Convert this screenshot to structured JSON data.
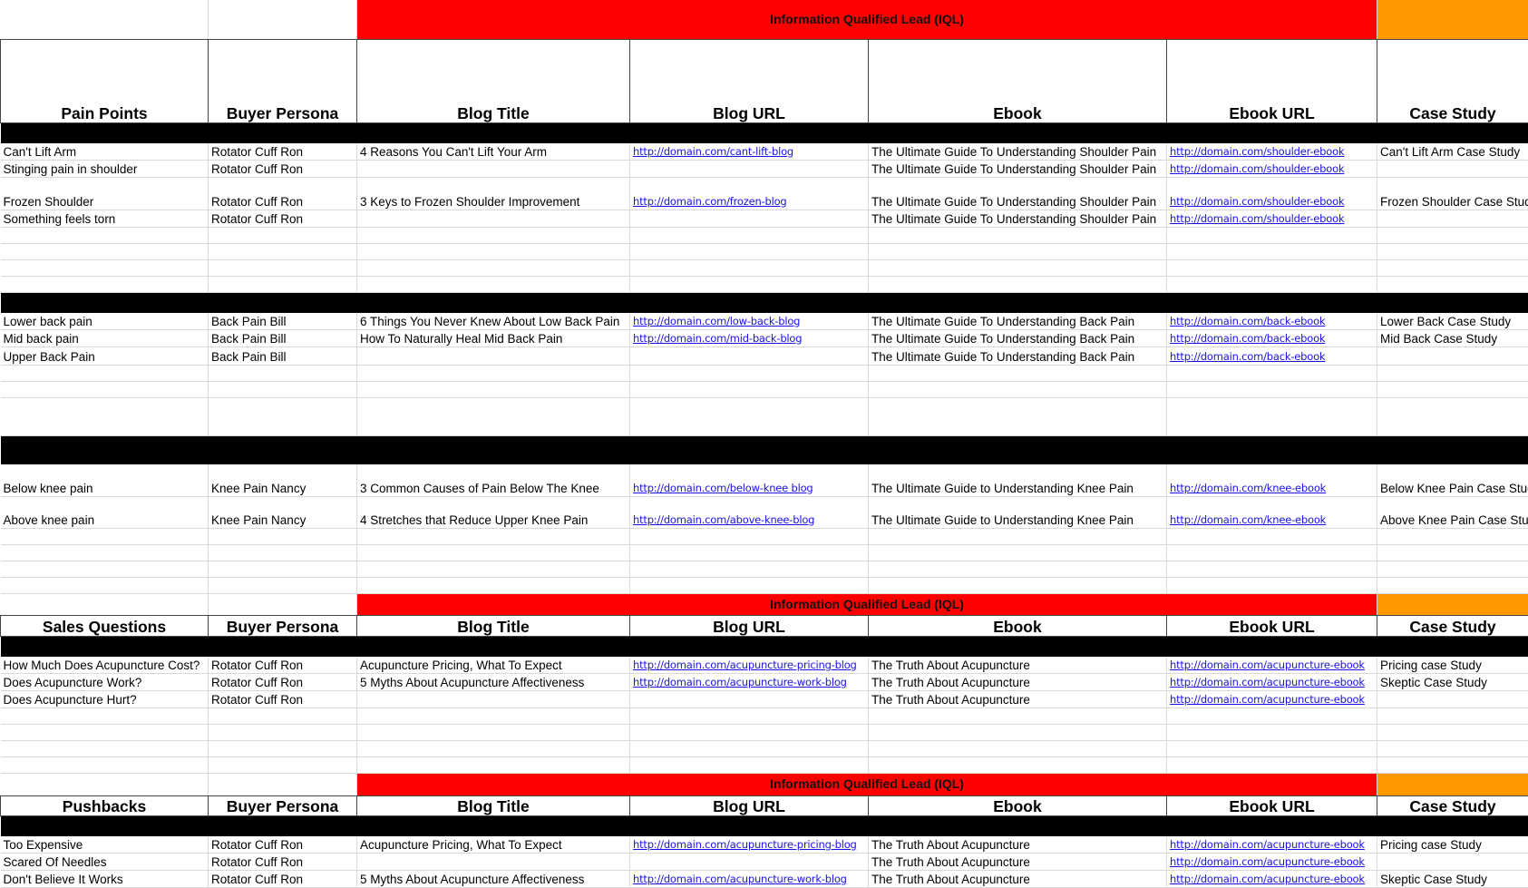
{
  "iql_label": "Information Qualified Lead (IQL)",
  "colors": {
    "iql_red": "#ff0000",
    "case_study_orange": "#ff9900",
    "section_divider": "#000000",
    "link": "#1a12e6"
  },
  "columns": [
    "Buyer Persona",
    "Blog Title",
    "Blog URL",
    "Ebook",
    "Ebook URL",
    "Case Study"
  ],
  "sections": [
    {
      "first_column": "Pain Points",
      "groups": [
        [
          [
            "Can't Lift Arm",
            "Rotator Cuff Ron",
            "4 Reasons You Can't Lift Your Arm",
            "http://domain.com/cant-lift-blog",
            "The Ultimate Guide To Understanding Shoulder Pain",
            "http://domain.com/shoulder-ebook",
            "Can't Lift Arm Case Study"
          ],
          [
            "Stinging pain in shoulder",
            "Rotator Cuff Ron",
            "",
            "",
            "The Ultimate Guide To Understanding Shoulder Pain",
            "http://domain.com/shoulder-ebook",
            ""
          ],
          [
            "Frozen Shoulder",
            "Rotator Cuff Ron",
            "3 Keys to Frozen Shoulder Improvement",
            "http://domain.com/frozen-blog",
            "The Ultimate Guide To Understanding Shoulder Pain",
            "http://domain.com/shoulder-ebook",
            "Frozen Shoulder Case Study"
          ],
          [
            "Something feels torn",
            "Rotator Cuff Ron",
            "",
            "",
            "The Ultimate Guide To Understanding Shoulder Pain",
            "http://domain.com/shoulder-ebook",
            ""
          ]
        ],
        [
          [
            "Lower back pain",
            "Back Pain Bill",
            "6 Things You Never Knew About Low Back Pain",
            "http://domain.com/low-back-blog",
            "The Ultimate Guide To Understanding Back Pain",
            "http://domain.com/back-ebook",
            "Lower Back Case Study"
          ],
          [
            "Mid back pain",
            "Back Pain Bill",
            "How To Naturally Heal Mid Back Pain",
            "http://domain.com/mid-back-blog",
            "The Ultimate Guide To Understanding Back Pain",
            "http://domain.com/back-ebook",
            "Mid Back Case Study"
          ],
          [
            "Upper Back Pain",
            "Back Pain Bill",
            "",
            "",
            "The Ultimate Guide To Understanding Back Pain",
            "http://domain.com/back-ebook",
            ""
          ]
        ],
        [
          [
            "Below knee pain",
            "Knee Pain Nancy",
            "3 Common Causes of Pain Below The Knee",
            "http://domain.com/below-knee blog",
            "The Ultimate Guide to Understanding Knee Pain",
            "http://domain.com/knee-ebook",
            "Below Knee Pain Case Study"
          ],
          [
            "Above knee pain",
            "Knee Pain Nancy",
            "4 Stretches that Reduce Upper Knee Pain",
            "http://domain.com/above-knee-blog",
            "The Ultimate Guide to Understanding Knee Pain",
            "http://domain.com/knee-ebook",
            "Above Knee Pain Case Study"
          ]
        ]
      ]
    },
    {
      "first_column": "Sales Questions",
      "groups": [
        [
          [
            "How Much Does Acupuncture Cost?",
            "Rotator Cuff Ron",
            "Acupuncture Pricing, What To Expect",
            "http://domain.com/acupuncture-pricing-blog",
            "The Truth About Acupuncture",
            "http://domain.com/acupuncture-ebook",
            "Pricing case Study"
          ],
          [
            "Does Acupuncture Work?",
            "Rotator Cuff Ron",
            "5 Myths About Acupuncture Affectiveness",
            "http://domain.com/acupuncture-work-blog",
            "The Truth About Acupuncture",
            "http://domain.com/acupuncture-ebook",
            "Skeptic Case Study"
          ],
          [
            "Does Acupuncture Hurt?",
            "Rotator Cuff Ron",
            "",
            "",
            "The Truth About Acupuncture",
            "http://domain.com/acupuncture-ebook",
            ""
          ]
        ]
      ]
    },
    {
      "first_column": "Pushbacks",
      "groups": [
        [
          [
            "Too Expensive",
            "Rotator Cuff Ron",
            "Acupuncture Pricing, What To Expect",
            "http://domain.com/acupuncture-pricing-blog",
            "The Truth About Acupuncture",
            "http://domain.com/acupuncture-ebook",
            "Pricing case Study"
          ],
          [
            "Scared Of Needles",
            "Rotator Cuff Ron",
            "",
            "",
            "The Truth About Acupuncture",
            "http://domain.com/acupuncture-ebook",
            ""
          ],
          [
            "Don't Believe It Works",
            "Rotator Cuff Ron",
            "5 Myths About Acupuncture Affectiveness",
            "http://domain.com/acupuncture-work-blog",
            "The Truth About Acupuncture",
            "http://domain.com/acupuncture-ebook",
            "Skeptic Case Study"
          ]
        ]
      ]
    }
  ]
}
